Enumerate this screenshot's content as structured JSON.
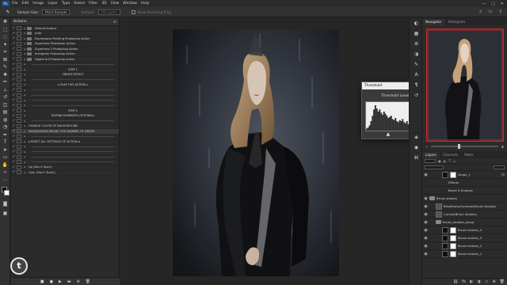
{
  "menubar": {
    "logo": "Ps",
    "items": [
      "File",
      "Edit",
      "Image",
      "Layer",
      "Type",
      "Select",
      "Filter",
      "3D",
      "View",
      "Window",
      "Help"
    ],
    "window_controls": [
      "—",
      "□",
      "✕"
    ]
  },
  "options_bar": {
    "sample_size_label": "Sample Size:",
    "sample_size_value": "Point Sample",
    "sample_label": "Sample:",
    "sample_value": "All Layers",
    "show_ring_label": "Show Sampling Ring"
  },
  "actions_panel": {
    "title": "Actions",
    "rows": [
      {
        "kind": "set",
        "text": "Default Actions"
      },
      {
        "kind": "set",
        "text": "Auto"
      },
      {
        "kind": "set",
        "text": "Expressions Painting Photoshop Action"
      },
      {
        "kind": "set",
        "text": "Superhero Photoshop Action"
      },
      {
        "kind": "set",
        "text": "Superhero 2 Photoshop Action"
      },
      {
        "kind": "set",
        "text": "Instagram Photoshop Action"
      },
      {
        "kind": "set",
        "text": "Digital Art Photoshop Action"
      },
      {
        "kind": "line",
        "text": ""
      },
      {
        "kind": "center",
        "text": "STEP 1"
      },
      {
        "kind": "center",
        "text": "CREATE EFFECT"
      },
      {
        "kind": "line",
        "text": ""
      },
      {
        "kind": "center",
        "text": "▸ PLAY THIS ACTION ◂"
      },
      {
        "kind": "line",
        "text": ""
      },
      {
        "kind": "line",
        "text": ""
      },
      {
        "kind": "line",
        "text": ""
      },
      {
        "kind": "line",
        "text": ""
      },
      {
        "kind": "center",
        "text": "STEP 2"
      },
      {
        "kind": "center",
        "text": "EDITING ELEMENTS (OPTIONAL)"
      },
      {
        "kind": "line",
        "text": ""
      },
      {
        "kind": "item",
        "text": "CHANGE COLOR OF BACKGROUND"
      },
      {
        "kind": "item_sel",
        "text": "INCREASE/DECREASE THE NUMBER OF DROPS"
      },
      {
        "kind": "line",
        "text": ""
      },
      {
        "kind": "item",
        "text": "▸ RESET ALL SETTINGS OF ACTION ◂"
      },
      {
        "kind": "line",
        "text": ""
      },
      {
        "kind": "line",
        "text": ""
      },
      {
        "kind": "line",
        "text": ""
      },
      {
        "kind": "line",
        "text": ""
      },
      {
        "kind": "item",
        "text": "Up (Don't Touch)"
      },
      {
        "kind": "item",
        "text": "Over (Don't Touch)"
      }
    ],
    "footer_icons": [
      "■",
      "●",
      "▶",
      "▬",
      "⊕",
      "🗑"
    ]
  },
  "watermark_letter": "t",
  "threshold_dialog": {
    "title": "Threshold",
    "level_label": "Threshold Level:",
    "level_value": "85",
    "level_fraction": 0.333,
    "ok_label": "OK",
    "cancel_label": "Cancel",
    "preview_label": "Preview",
    "preview_checked": true,
    "histogram": [
      2,
      3,
      5,
      9,
      14,
      20,
      24,
      21,
      18,
      20,
      17,
      15,
      18,
      16,
      14,
      12,
      13,
      14,
      11,
      10,
      12,
      9,
      8,
      10,
      9,
      11,
      8,
      7,
      9,
      6,
      8,
      7,
      6,
      5,
      7,
      6,
      5,
      4,
      5,
      3,
      4,
      3,
      2,
      3,
      2,
      2,
      1,
      1
    ]
  },
  "right_panel": {
    "nav_tabs": [
      "Navigator",
      "Histogram"
    ],
    "zoom_value": "",
    "layer_tabs": [
      "Layers",
      "Channels",
      "Paths"
    ],
    "layers": [
      {
        "name": "Drops_1",
        "type": "layer",
        "indent": 2,
        "fx": true,
        "selected": false
      },
      {
        "name": "Effects",
        "type": "effect",
        "indent": 3
      },
      {
        "name": "Bevel & Emboss",
        "type": "effect",
        "indent": 3
      },
      {
        "name": "Brush strokes",
        "type": "group",
        "indent": 0
      },
      {
        "name": "Brightness/Contrast(Brush strokes)",
        "type": "adj",
        "indent": 1
      },
      {
        "name": "Curves(Brush strokes)",
        "type": "adj",
        "indent": 1
      },
      {
        "name": "Brush_strokes_group",
        "type": "group",
        "indent": 1
      },
      {
        "name": "Brush strokes_4",
        "type": "layer",
        "indent": 2
      },
      {
        "name": "Brush strokes_3",
        "type": "layer",
        "indent": 2
      },
      {
        "name": "Brush strokes_2",
        "type": "layer",
        "indent": 2
      },
      {
        "name": "Brush strokes_1",
        "type": "layer",
        "indent": 2
      }
    ],
    "footer_icons": [
      "⛓",
      "fx",
      "◐",
      "◑",
      "▭",
      "⊕",
      "🗑"
    ]
  },
  "colors": {
    "accent": "#c62a2a",
    "dialog_input_border": "#6aa3ff"
  }
}
